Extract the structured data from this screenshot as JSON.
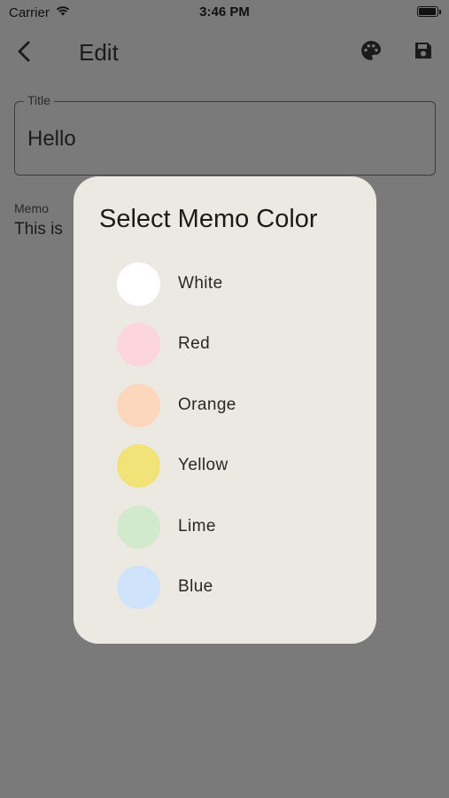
{
  "status_bar": {
    "carrier": "Carrier",
    "time": "3:46 PM"
  },
  "app_bar": {
    "title": "Edit",
    "back_icon": "chevron-left-icon",
    "palette_icon": "palette-icon",
    "save_icon": "save-icon"
  },
  "title_field": {
    "label": "Title",
    "value": "Hello"
  },
  "memo": {
    "label": "Memo",
    "value": "This is"
  },
  "dialog": {
    "title": "Select Memo Color",
    "colors": [
      {
        "label": "White",
        "color": "#ffffff"
      },
      {
        "label": "Red",
        "color": "#fdd5dd"
      },
      {
        "label": "Orange",
        "color": "#fdd7bb"
      },
      {
        "label": "Yellow",
        "color": "#f1e377"
      },
      {
        "label": "Lime",
        "color": "#d2e9ce"
      },
      {
        "label": "Blue",
        "color": "#cfe3fb"
      }
    ]
  },
  "colors": {
    "scrim_background": "#7a7a7a",
    "dialog_background": "#ece8e2"
  }
}
